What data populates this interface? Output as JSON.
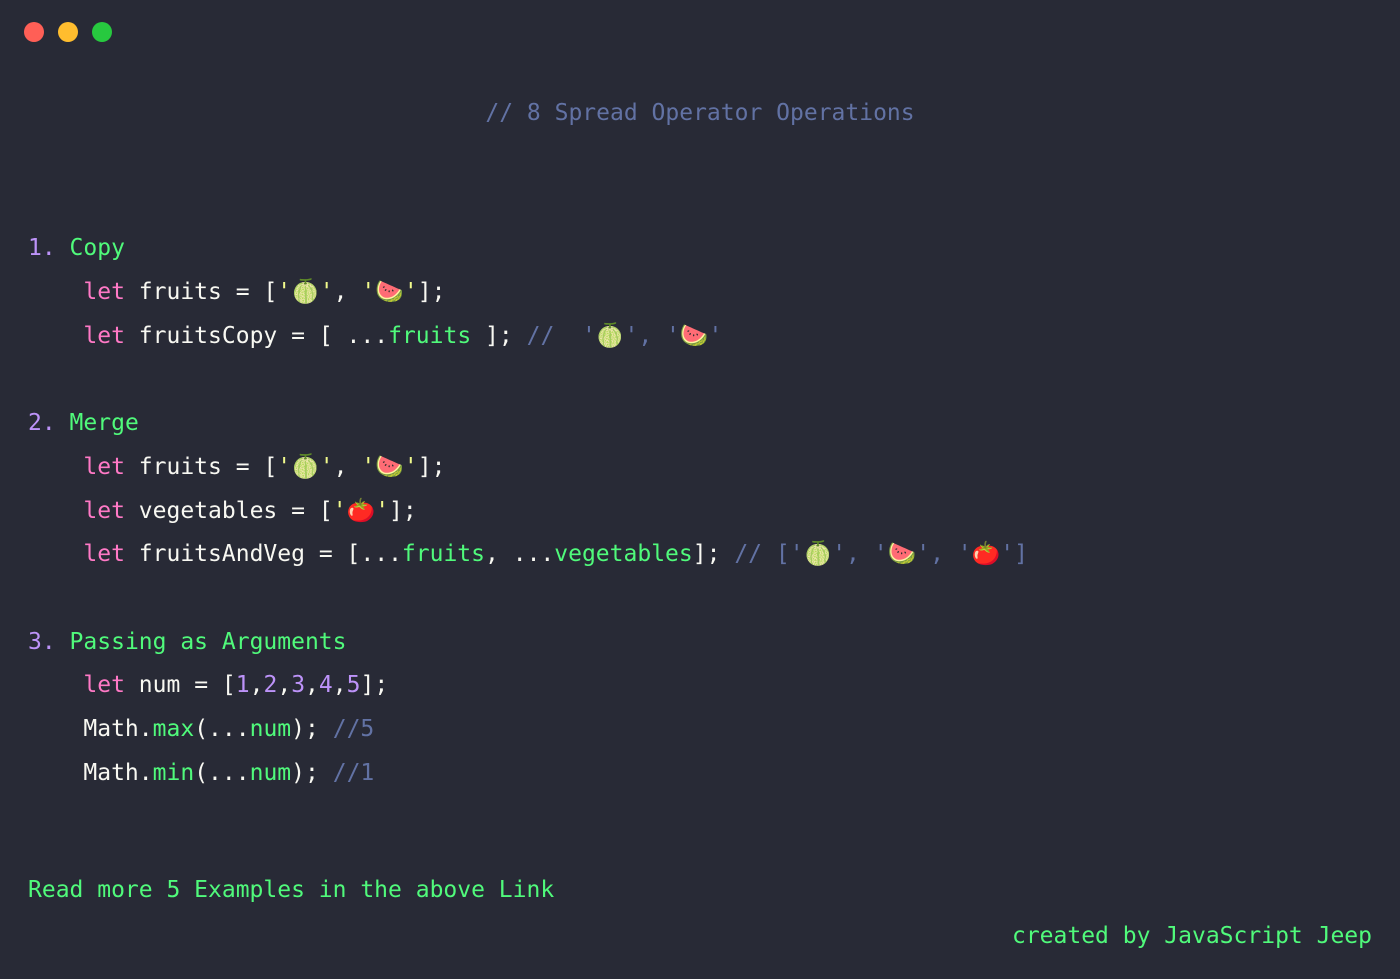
{
  "title_comment": "// 8 Spread Operator Operations",
  "sections": {
    "s1": {
      "num": "1.",
      "title": " Copy"
    },
    "s2": {
      "num": "2.",
      "title": " Merge"
    },
    "s3": {
      "num": "3.",
      "title": " Passing as Arguments"
    }
  },
  "tok": {
    "let": "let",
    "fruits": "fruits",
    "fruitsCopy": "fruitsCopy",
    "vegetables": "vegetables",
    "fruitsAndVeg": "fruitsAndVeg",
    "num": "num",
    "Math": "Math",
    "max": "max",
    "min": "min",
    "eq": " = ",
    "lbr": "[",
    "rbr": "]",
    "semi": ";",
    "comma": ",",
    "comma_sp": ", ",
    "dot": ".",
    "lp": "(",
    "rp": ")",
    "spread": "...",
    "sp": " ",
    "q": "'",
    "melon": "🍈",
    "wmelon": "🍉",
    "tomato": "🍅",
    "cmt_copy": "//  '🍈', '🍉'",
    "cmt_merge": "// ['🍈', '🍉', '🍅']",
    "cmt5": "//5",
    "cmt1": "//1",
    "n1": "1",
    "n2": "2",
    "n3": "3",
    "n4": "4",
    "n5": "5"
  },
  "footer_left": "Read more 5 Examples in the above Link",
  "footer_right": "created by JavaScript Jeep"
}
